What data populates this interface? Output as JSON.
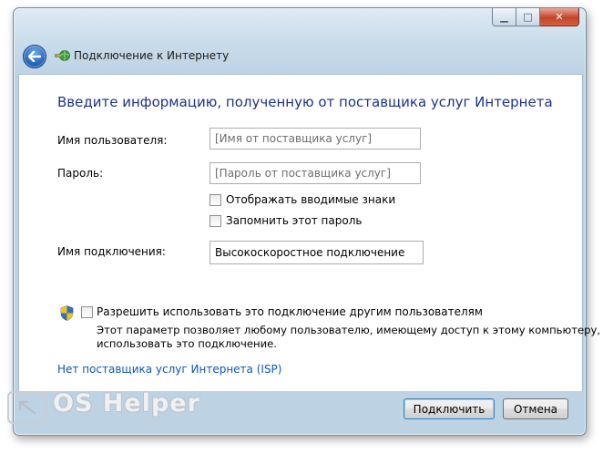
{
  "window": {
    "title": "Подключение к Интернету",
    "minimize_symbol": "▁",
    "maximize_symbol": "□",
    "close_symbol": "✕"
  },
  "form": {
    "heading": "Введите информацию, полученную от поставщика услуг Интернета",
    "username_label": "Имя пользователя:",
    "username_placeholder": "[Имя от поставщика услуг]",
    "password_label": "Пароль:",
    "password_placeholder": "[Пароль от поставщика услуг]",
    "show_chars_label": "Отображать вводимые знаки",
    "show_chars_checked": false,
    "remember_password_label": "Запомнить этот пароль",
    "remember_password_checked": false,
    "connection_name_label": "Имя подключения:",
    "connection_name_value": "Высокоскоростное подключение",
    "allow_others_label": "Разрешить использовать это подключение другим пользователям",
    "allow_others_checked": false,
    "allow_others_description_line1": "Этот параметр позволяет любому пользователю, имеющему доступ к этому компьютеру,",
    "allow_others_description_line2": "использовать это подключение.",
    "no_isp_link": "Нет поставщика услуг Интернета (ISP)"
  },
  "buttons": {
    "connect": "Подключить",
    "cancel": "Отмена"
  },
  "watermark": "OS Helper",
  "icons": {
    "back": "back-arrow-icon",
    "title": "network-globe-icon",
    "shield": "uac-shield-icon"
  },
  "colors": {
    "heading": "#1e3287",
    "link": "#0f55b5",
    "close_button": "#c44428"
  }
}
